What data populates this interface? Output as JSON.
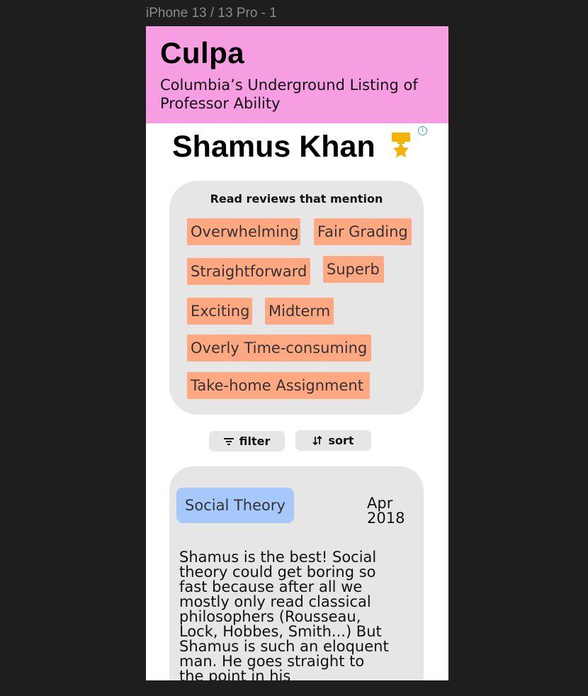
{
  "frame_label": "iPhone 13 / 13 Pro - 1",
  "app": {
    "title": "Culpa",
    "subtitle": "Columbia’s Underground Listing of Professor Ability",
    "header_color": "#f79ee3"
  },
  "professor": {
    "name": "Shamus Khan",
    "badge_icon": "gold-medal-icon",
    "info_icon": "info-icon"
  },
  "tags": {
    "title": "Read reviews that mention",
    "items": [
      "Overwhelming",
      "Fair Grading",
      "Straightforward",
      "Superb",
      "Exciting",
      "Midterm",
      "Overly Time-consuming",
      "Take-home Assignment"
    ],
    "tag_color": "#ffa882"
  },
  "controls": {
    "filter_label": "filter",
    "filter_icon": "filter-icon",
    "sort_label": "sort",
    "sort_icon": "sort-arrows-icon"
  },
  "review": {
    "course": "Social Theory",
    "course_color": "#a7c8fb",
    "date": "Apr 2018",
    "body": "Shamus is the best! Social theory could get boring so fast because after all we mostly only read classical philosophers (Rousseau, Lock, Hobbes, Smith...) But Shamus is such an eloquent man. He goes straight to the point in his"
  }
}
